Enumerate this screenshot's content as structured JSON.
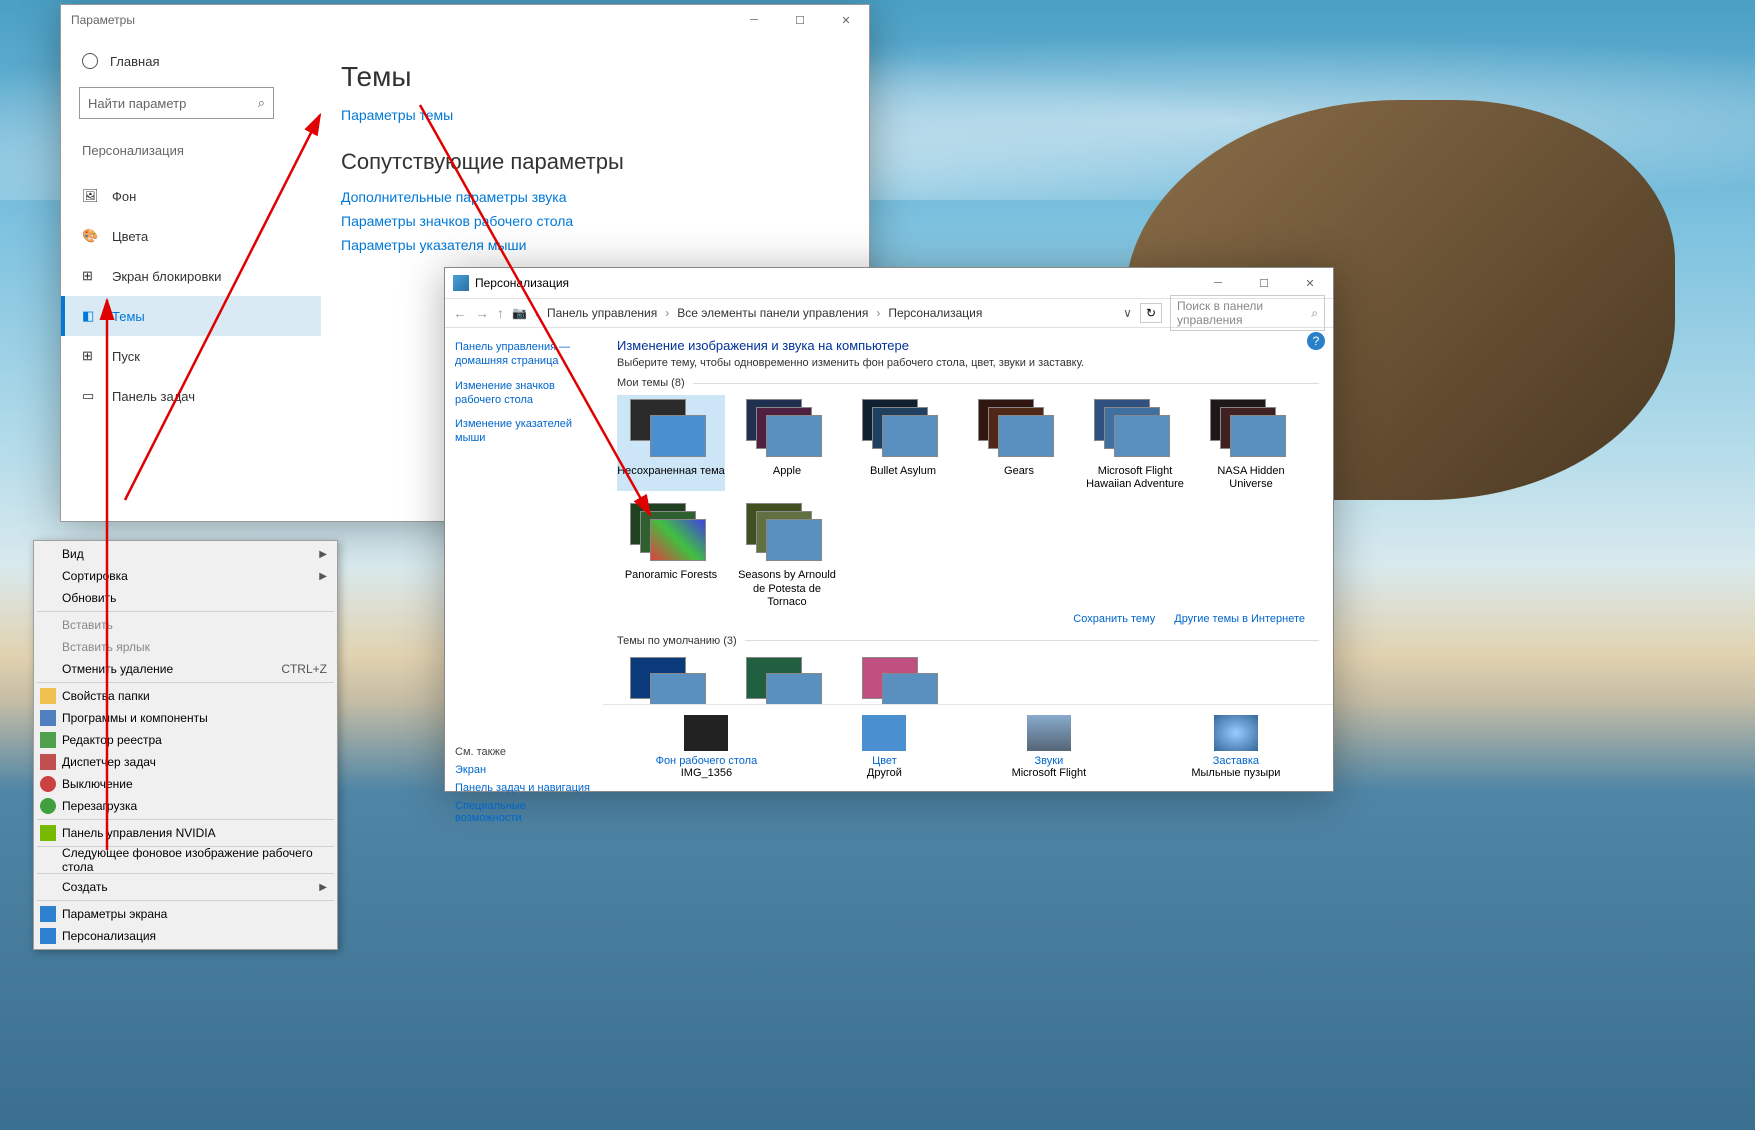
{
  "settings": {
    "title": "Параметры",
    "home": "Главная",
    "search_placeholder": "Найти параметр",
    "section": "Персонализация",
    "nav": {
      "bg": "Фон",
      "colors": "Цвета",
      "lock": "Экран блокировки",
      "themes": "Темы",
      "start": "Пуск",
      "taskbar": "Панель задач"
    },
    "right": {
      "h1": "Темы",
      "link1": "Параметры темы",
      "h2": "Сопутствующие параметры",
      "link2": "Дополнительные параметры звука",
      "link3": "Параметры значков рабочего стола",
      "link4": "Параметры указателя мыши"
    }
  },
  "ctx": {
    "view": "Вид",
    "sort": "Сортировка",
    "refresh": "Обновить",
    "paste": "Вставить",
    "paste_lnk": "Вставить ярлык",
    "undo": "Отменить удаление",
    "undo_sc": "CTRL+Z",
    "folder_props": "Свойства папки",
    "programs": "Программы и компоненты",
    "regedit": "Редактор реестра",
    "taskmgr": "Диспетчер задач",
    "shutdown": "Выключение",
    "reboot": "Перезагрузка",
    "nvidia": "Панель управления NVIDIA",
    "next_wall": "Следующее фоновое изображение рабочего стола",
    "create": "Создать",
    "disp": "Параметры экрана",
    "pers": "Персонализация"
  },
  "pers": {
    "title": "Персонализация",
    "crumbs": {
      "c1": "Панель управления",
      "c2": "Все элементы панели управления",
      "c3": "Персонализация"
    },
    "search": "Поиск в панели управления",
    "left": {
      "home": "Панель управления — домашняя страница",
      "icons": "Изменение значков рабочего стола",
      "mouse": "Изменение указателей мыши",
      "see": "См. также",
      "disp": "Экран",
      "tasknav": "Панель задач и навигация",
      "ease": "Специальные возможности"
    },
    "main": {
      "h3": "Изменение изображения и звука на компьютере",
      "desc": "Выберите тему, чтобы одновременно изменить фон рабочего стола, цвет, звуки и заставку.",
      "my_themes": "Мои темы (8)",
      "save": "Сохранить тему",
      "more": "Другие темы в Интернете",
      "default_themes": "Темы по умолчанию (3)"
    },
    "themes": {
      "t1": "Несохраненная тема",
      "t2": "Apple",
      "t3": "Bullet Asylum",
      "t4": "Gears",
      "t5": "Microsoft Flight Hawaiian Adventure",
      "t6": "NASA Hidden Universe",
      "t7": "Panoramic Forests",
      "t8": "Seasons by Arnould de Potesta de Tornaco"
    },
    "bottom": {
      "wall": "Фон рабочего стола",
      "wall_v": "IMG_1356",
      "color": "Цвет",
      "color_v": "Другой",
      "sounds": "Звуки",
      "sounds_v": "Microsoft Flight",
      "saver": "Заставка",
      "saver_v": "Мыльные пузыри"
    }
  }
}
